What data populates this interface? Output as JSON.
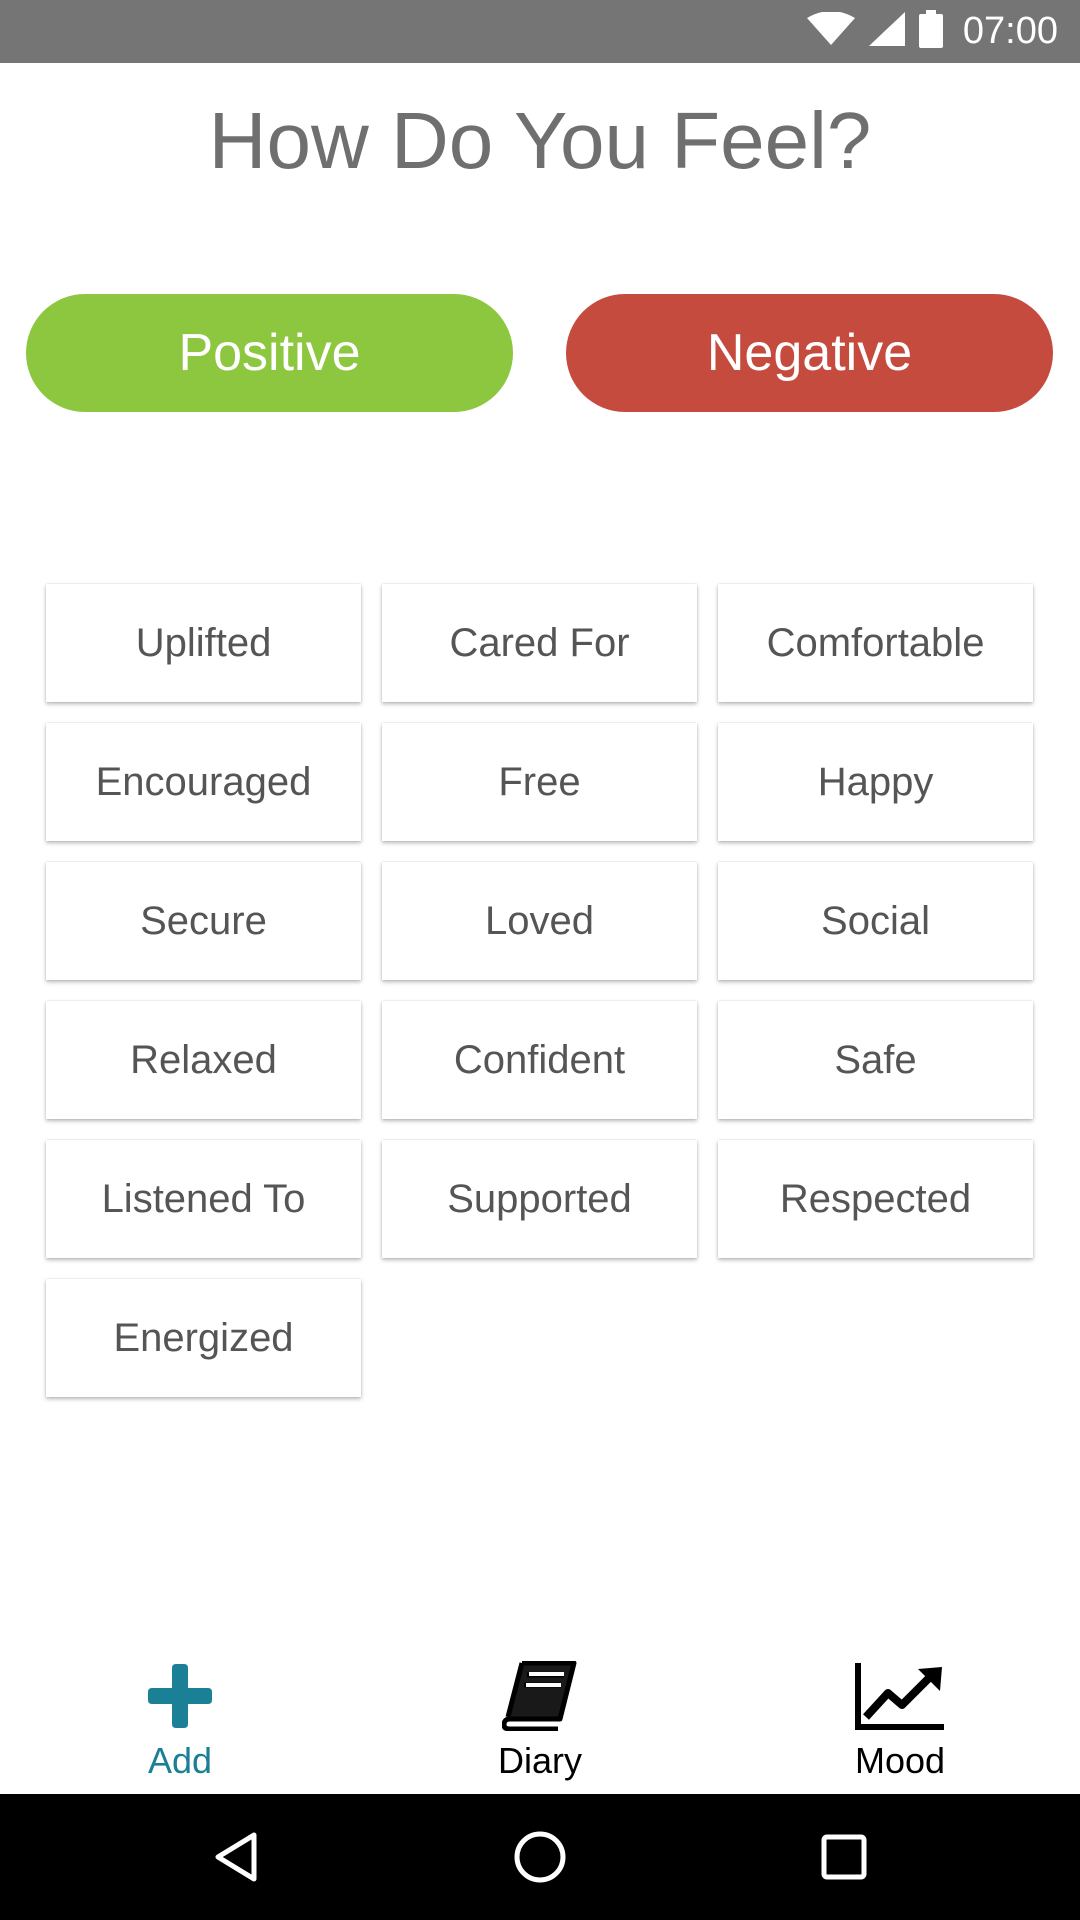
{
  "status_bar": {
    "time": "07:00",
    "icons": [
      "wifi-icon",
      "cell-signal-icon",
      "battery-icon"
    ]
  },
  "page": {
    "title": "How Do You Feel?"
  },
  "toggle": {
    "positive_label": "Positive",
    "negative_label": "Negative",
    "positive_color": "#8dc63f",
    "negative_color": "#c64b3f"
  },
  "feelings": [
    "Uplifted",
    "Cared For",
    "Comfortable",
    "Encouraged",
    "Free",
    "Happy",
    "Secure",
    "Loved",
    "Social",
    "Relaxed",
    "Confident",
    "Safe",
    "Listened To",
    "Supported",
    "Respected",
    "Energized"
  ],
  "bottom_nav": {
    "items": [
      {
        "label": "Add",
        "icon": "plus-icon",
        "active": true,
        "color": "#1b7f95"
      },
      {
        "label": "Diary",
        "icon": "book-icon",
        "active": false,
        "color": "#000000"
      },
      {
        "label": "Mood",
        "icon": "chart-line-icon",
        "active": false,
        "color": "#000000"
      }
    ]
  },
  "system_nav": {
    "icons": [
      "back-icon",
      "home-icon",
      "recents-icon"
    ]
  }
}
